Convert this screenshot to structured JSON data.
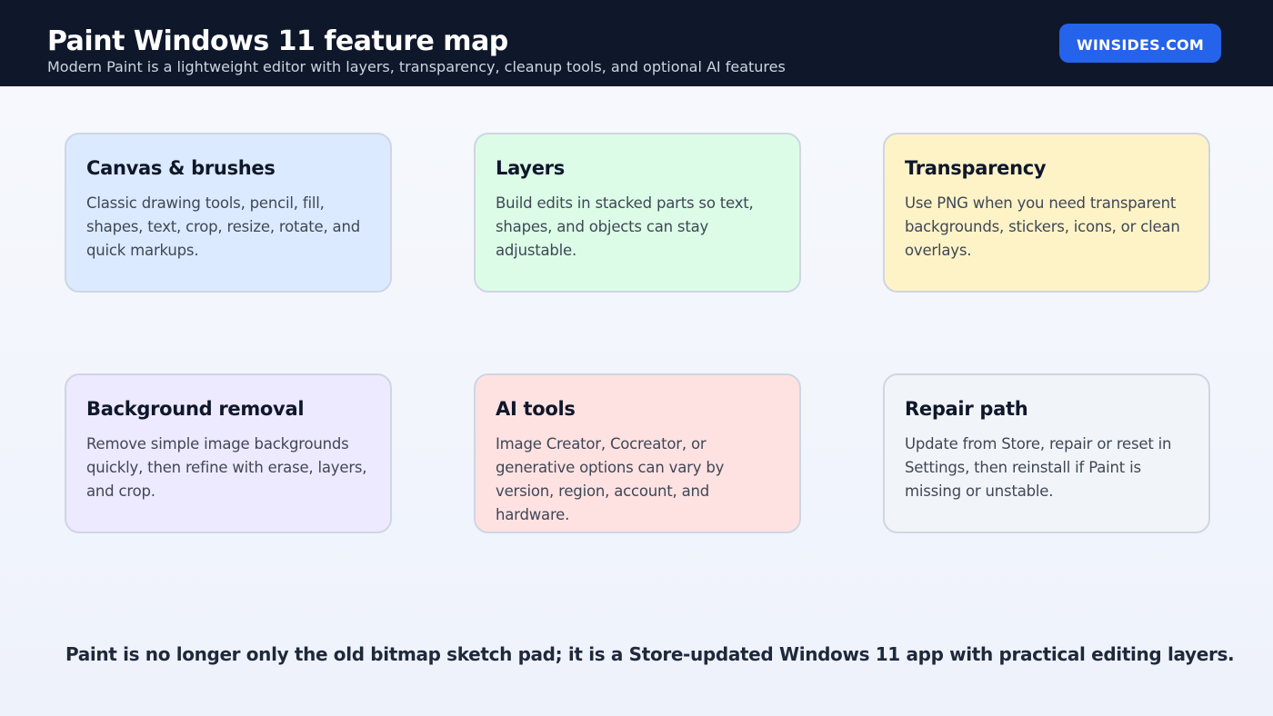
{
  "header": {
    "title": "Paint Windows 11 feature map",
    "subtitle": "Modern Paint is a lightweight editor with layers, transparency, cleanup tools, and optional AI features",
    "brand_label": "WINSIDES.COM"
  },
  "cards": [
    {
      "title": "Canvas & brushes",
      "text": "Classic drawing tools, pencil, fill, shapes, text, crop, resize, rotate, and quick markups.",
      "color": "#dbeafe"
    },
    {
      "title": "Layers",
      "text": "Build edits in stacked parts so text, shapes, and objects can stay adjustable.",
      "color": "#dcfce7"
    },
    {
      "title": "Transparency",
      "text": "Use PNG when you need transparent backgrounds, stickers, icons, or clean overlays.",
      "color": "#fef3c7"
    },
    {
      "title": "Background removal",
      "text": "Remove simple image backgrounds quickly, then refine with erase, layers, and crop.",
      "color": "#ede9fe"
    },
    {
      "title": "AI tools",
      "text": "Image Creator, Cocreator, or generative options can vary by version, region, account, and hardware.",
      "color": "#fee2e2"
    },
    {
      "title": "Repair path",
      "text": "Update from Store, repair or reset in Settings, then reinstall if Paint is missing or unstable.",
      "color": "#f1f5f9"
    }
  ],
  "footer": {
    "note": "Paint is no longer only the old bitmap sketch pad; it is a Store-updated Windows 11 app with practical editing layers."
  },
  "colors": {
    "header_bg": "#0f172a",
    "brand_button": "#2563eb",
    "card_border": "#cfd6e2"
  }
}
